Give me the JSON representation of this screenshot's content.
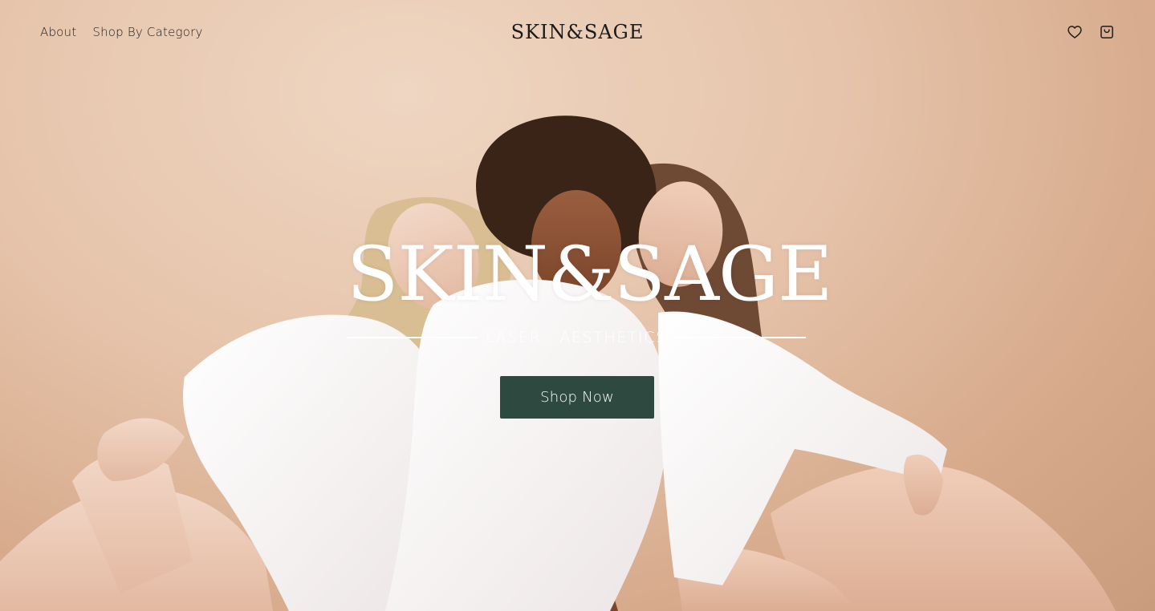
{
  "header": {
    "nav": [
      {
        "label": "About"
      },
      {
        "label": "Shop By Category"
      }
    ],
    "logo": "SKIN&SAGE",
    "icons": [
      "heart-icon",
      "shopping-bag-icon"
    ]
  },
  "hero": {
    "brand_title": "SKIN&SAGE",
    "tagline": "LASER . AESTHETICS",
    "cta_label": "Shop Now"
  },
  "colors": {
    "background": "#e6c4ab",
    "cta_background": "#2e4a40",
    "text_dark": "#1d1d1d",
    "shirt_white": "#f6f2f1"
  }
}
